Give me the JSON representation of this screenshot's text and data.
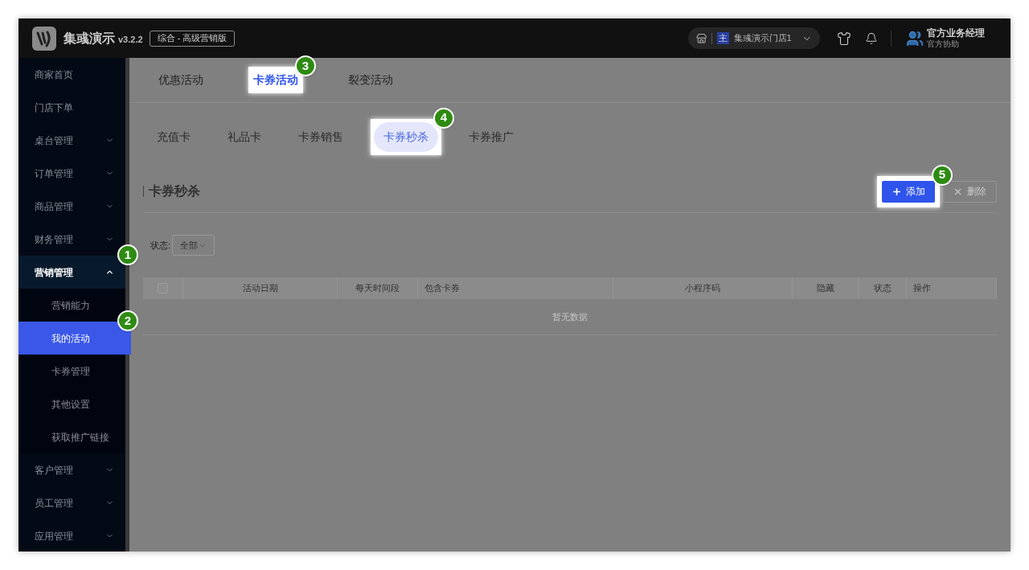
{
  "header": {
    "brand": "集彧演示",
    "version": "v3.2.2",
    "edition": "综合 - 高级营销版",
    "store_badge": "主",
    "store": "集彧演示门店1",
    "user_name": "官方业务经理",
    "user_role": "官方协助"
  },
  "sidebar": {
    "items": [
      {
        "label": "商家首页",
        "kind": "link",
        "selected": false
      },
      {
        "label": "门店下单",
        "kind": "link",
        "selected": false
      },
      {
        "label": "桌台管理",
        "kind": "group",
        "expanded": false
      },
      {
        "label": "订单管理",
        "kind": "group",
        "expanded": false
      },
      {
        "label": "商品管理",
        "kind": "group",
        "expanded": false
      },
      {
        "label": "财务管理",
        "kind": "group",
        "expanded": false
      },
      {
        "label": "营销管理",
        "kind": "group",
        "expanded": true,
        "step": "1",
        "children": [
          {
            "label": "营销能力",
            "selected": false
          },
          {
            "label": "我的活动",
            "selected": true,
            "step": "2"
          },
          {
            "label": "卡券管理",
            "selected": false
          },
          {
            "label": "其他设置",
            "selected": false
          },
          {
            "label": "获取推广链接",
            "selected": false
          }
        ]
      },
      {
        "label": "客户管理",
        "kind": "group",
        "expanded": false
      },
      {
        "label": "员工管理",
        "kind": "group",
        "expanded": false
      },
      {
        "label": "应用管理",
        "kind": "group",
        "expanded": false
      }
    ]
  },
  "tabs": [
    {
      "label": "优惠活动",
      "selected": false
    },
    {
      "label": "卡券活动",
      "selected": true,
      "step": "3"
    },
    {
      "label": "裂变活动",
      "selected": false
    }
  ],
  "sub_tabs": [
    {
      "label": "充值卡",
      "selected": false
    },
    {
      "label": "礼品卡",
      "selected": false
    },
    {
      "label": "卡券销售",
      "selected": false
    },
    {
      "label": "卡券秒杀",
      "selected": true,
      "step": "4"
    },
    {
      "label": "卡券推广",
      "selected": false
    }
  ],
  "section": {
    "title": "卡券秒杀",
    "add_button": {
      "label": "添加",
      "step": "5",
      "disabled": false
    },
    "delete_button": {
      "label": "删除",
      "disabled": true
    }
  },
  "filter": {
    "label": "状态:",
    "value": "全部"
  },
  "table": {
    "select_all": {
      "checked": false
    },
    "columns": [
      {
        "label": "活动日期"
      },
      {
        "label": "每天时间段"
      },
      {
        "label": "包含卡券"
      },
      {
        "label": "小程序码"
      },
      {
        "label": "隐藏"
      },
      {
        "label": "状态"
      },
      {
        "label": "操作"
      }
    ],
    "empty_text": "暂无数据"
  }
}
